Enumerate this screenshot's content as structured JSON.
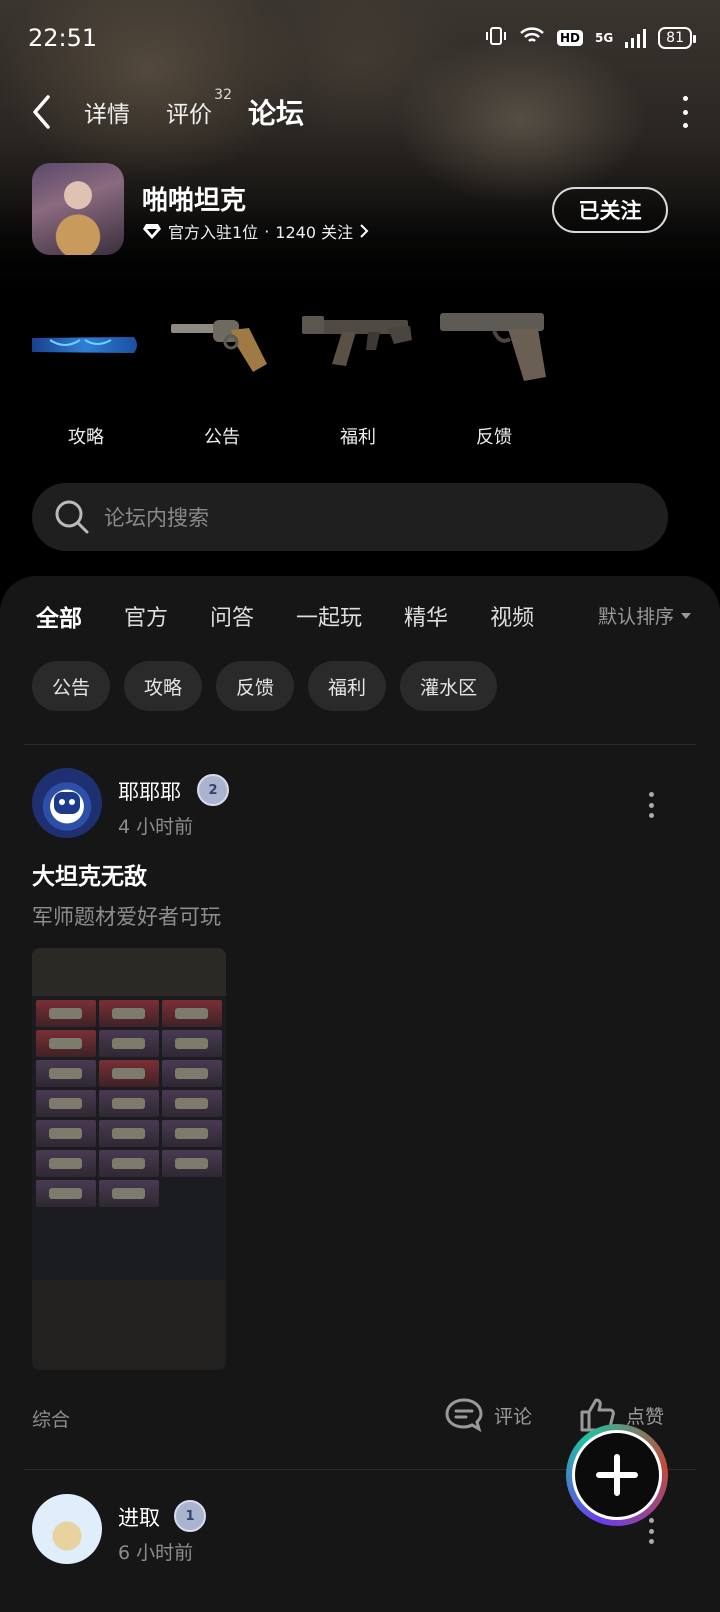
{
  "status_bar": {
    "time": "22:51",
    "network": "5G",
    "hd": "HD",
    "battery": "81"
  },
  "nav": {
    "tabs": [
      {
        "label": "详情"
      },
      {
        "label": "评价",
        "count": "32"
      },
      {
        "label": "论坛"
      }
    ]
  },
  "game": {
    "name": "啪啪坦克",
    "official": "官方入驻1位",
    "separator": "·",
    "followers": "1240 关注",
    "follow_label": "已关注"
  },
  "categories": [
    {
      "label": "攻略",
      "icon": "bullet-icon"
    },
    {
      "label": "公告",
      "icon": "revolver-icon"
    },
    {
      "label": "福利",
      "icon": "rifle-icon"
    },
    {
      "label": "反馈",
      "icon": "pistol-icon"
    }
  ],
  "search": {
    "placeholder": "论坛内搜索"
  },
  "forum_tabs": [
    "全部",
    "官方",
    "问答",
    "一起玩",
    "精华",
    "视频"
  ],
  "sort": {
    "label": "默认排序"
  },
  "chips": [
    "公告",
    "攻略",
    "反馈",
    "福利",
    "灌水区"
  ],
  "posts": [
    {
      "user": "耶耶耶",
      "level": "2",
      "time": "4 小时前",
      "title": "大坦克无敌",
      "desc": "军师题材爱好者可玩",
      "tag": "综合",
      "comment_label": "评论",
      "like_label": "点赞"
    },
    {
      "user": "进取",
      "level": "1",
      "time": "6 小时前"
    }
  ],
  "colors": {
    "accent": "#1fc3a3",
    "panel": "#161616"
  }
}
